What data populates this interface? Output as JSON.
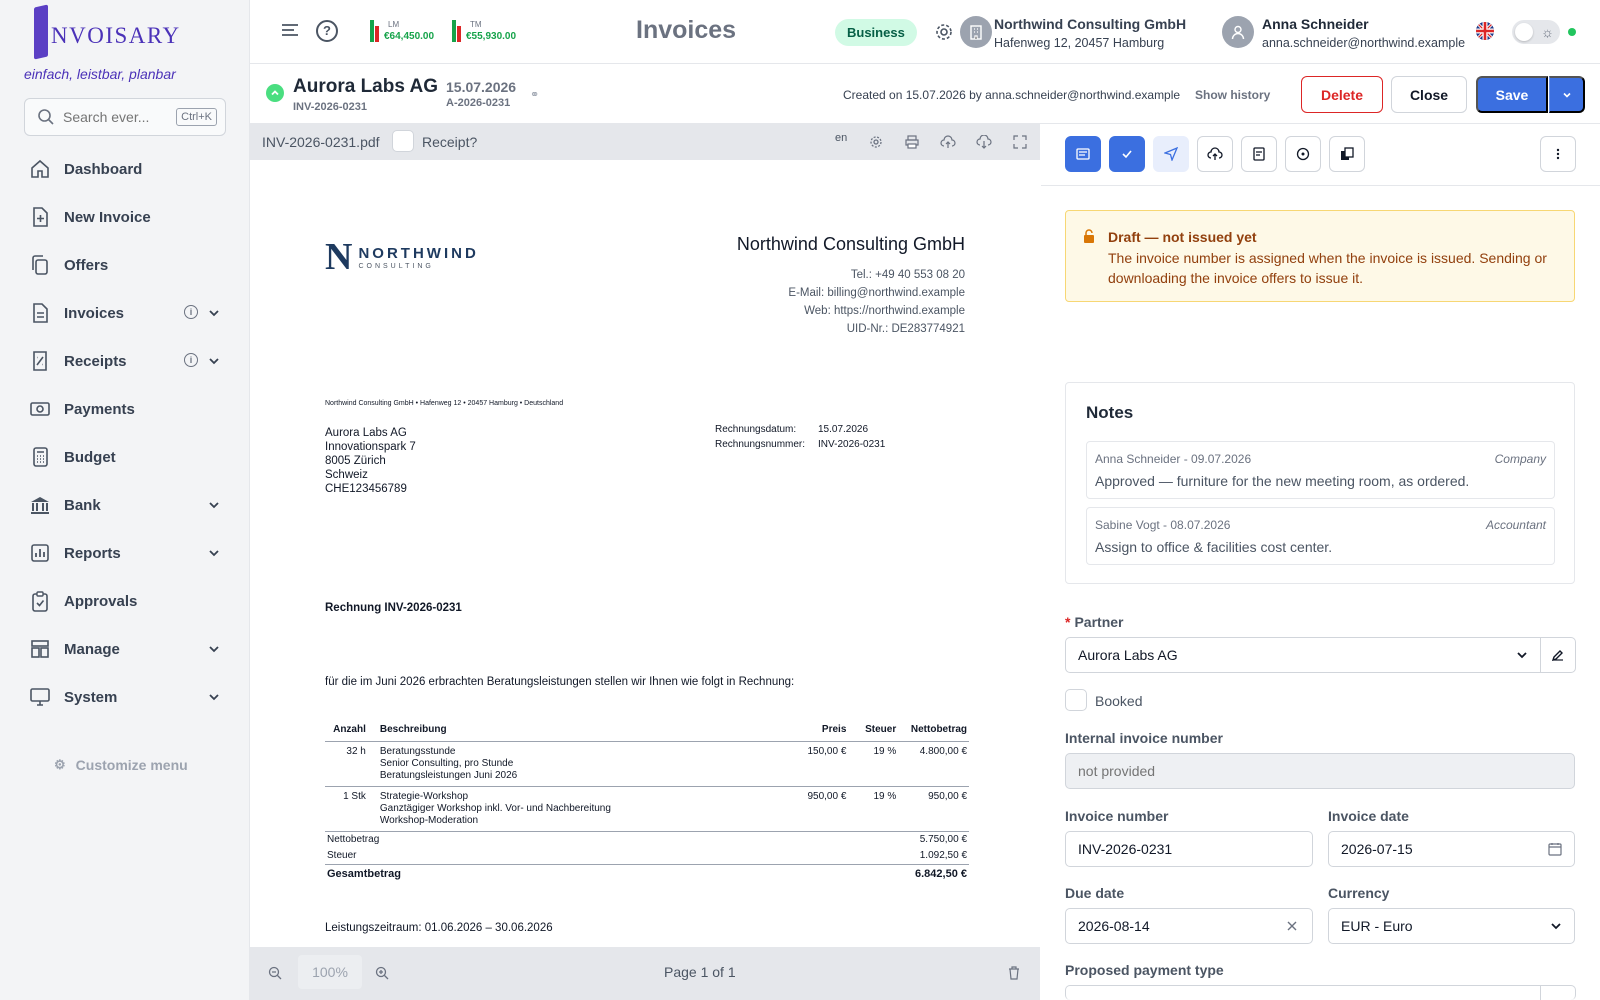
{
  "app": {
    "logo_text": "NVOISARY",
    "tagline": "einfach, leistbar, planbar",
    "search_placeholder": "Search ever...",
    "search_shortcut": "Ctrl+K",
    "customize_menu": "Customize menu"
  },
  "sidebar": {
    "items": [
      {
        "label": "Dashboard",
        "icon": "home-icon"
      },
      {
        "label": "New Invoice",
        "icon": "file-plus-icon"
      },
      {
        "label": "Offers",
        "icon": "copy-icon"
      },
      {
        "label": "Invoices",
        "icon": "file-icon"
      },
      {
        "label": "Receipts",
        "icon": "receipt-icon"
      },
      {
        "label": "Payments",
        "icon": "money-icon"
      },
      {
        "label": "Budget",
        "icon": "calculator-icon"
      },
      {
        "label": "Bank",
        "icon": "bank-icon"
      },
      {
        "label": "Reports",
        "icon": "chart-icon"
      },
      {
        "label": "Approvals",
        "icon": "clipboard-check-icon"
      },
      {
        "label": "Manage",
        "icon": "dashboard-icon"
      },
      {
        "label": "System",
        "icon": "monitor-icon"
      }
    ]
  },
  "topbar": {
    "kpi_lm_label": "LM",
    "kpi_lm_value": "€64,450.00",
    "kpi_tm_label": "TM",
    "kpi_tm_value": "€55,930.00",
    "title": "Invoices",
    "plan_badge": "Business",
    "company_name": "Northwind Consulting GmbH",
    "company_address": "Hafenweg 12, 20457 Hamburg",
    "user_name": "Anna Schneider",
    "user_email": "anna.schneider@northwind.example",
    "colors": {
      "accent": "#3b6fe0",
      "kpi_green": "#16a34a",
      "kpi_red": "#dc2626"
    }
  },
  "header": {
    "partner": "Aurora Labs AG",
    "invoice_number": "INV-2026-0231",
    "date": "15.07.2026",
    "alt_number": "A-2026-0231",
    "created": "Created on 15.07.2026 by anna.schneider@northwind.example",
    "show_history": "Show history",
    "delete": "Delete",
    "close": "Close",
    "save": "Save"
  },
  "viewer": {
    "filename": "INV-2026-0231.pdf",
    "receipt_label": "Receipt?",
    "lang": "en",
    "zoom": "100%",
    "page_indicator": "Page 1 of 1"
  },
  "pdf": {
    "logo_word": "NORTHWIND",
    "logo_sub": "CONSULTING",
    "company": "Northwind Consulting GmbH",
    "tel": "Tel.: +49 40 553 08 20",
    "email": "E-Mail: billing@northwind.example",
    "web": "Web: https://northwind.example",
    "vat": "UID-Nr.: DE283774921",
    "sender_line": "Northwind Consulting GmbH • Hafenweg 12 • 20457 Hamburg • Deutschland",
    "recipient": [
      "Aurora Labs AG",
      "Innovationspark 7",
      "8005 Zürich",
      "Schweiz",
      "CHE123456789"
    ],
    "meta_date_label": "Rechnungsdatum:",
    "meta_date_value": "15.07.2026",
    "meta_no_label": "Rechnungsnummer:",
    "meta_no_value": "INV-2026-0231",
    "heading": "Rechnung INV-2026-0231",
    "intro": "für die im Juni 2026 erbrachten Beratungsleistungen stellen wir Ihnen wie folgt in Rechnung:",
    "columns": {
      "qty": "Anzahl",
      "desc": "Beschreibung",
      "price": "Preis",
      "tax": "Steuer",
      "net": "Nettobetrag"
    },
    "lines": [
      {
        "qty": "32 h",
        "desc1": "Beratungsstunde",
        "desc2": "Senior Consulting, pro Stunde",
        "desc3": "Beratungsleistungen Juni 2026",
        "price": "150,00 €",
        "tax": "19 %",
        "net": "4.800,00 €"
      },
      {
        "qty": "1 Stk",
        "desc1": "Strategie-Workshop",
        "desc2": "Ganztägiger Workshop inkl. Vor- und Nachbereitung",
        "desc3": "Workshop-Moderation",
        "price": "950,00 €",
        "tax": "19 %",
        "net": "950,00 €"
      }
    ],
    "net_label": "Nettobetrag",
    "net_value": "5.750,00 €",
    "tax_label": "Steuer",
    "tax_value": "1.092,50 €",
    "total_label": "Gesamtbetrag",
    "total_value": "6.842,50 €",
    "period": "Leistungszeitraum: 01.06.2026 – 30.06.2026"
  },
  "panel": {
    "draft_title": "Draft — not issued yet",
    "draft_body": "The invoice number is assigned when the invoice is issued. Sending or downloading the invoice offers to issue it.",
    "notes_title": "Notes",
    "notes": [
      {
        "meta": "Anna Schneider - 09.07.2026",
        "role": "Company",
        "text": "Approved — furniture for the new meeting room, as ordered."
      },
      {
        "meta": "Sabine Vogt - 08.07.2026",
        "role": "Accountant",
        "text": "Assign to office & facilities cost center."
      }
    ],
    "partner_label": "Partner",
    "partner_value": "Aurora Labs AG",
    "booked_label": "Booked",
    "internal_label": "Internal invoice number",
    "internal_placeholder": "not provided",
    "invoice_number_label": "Invoice number",
    "invoice_number_value": "INV-2026-0231",
    "invoice_date_label": "Invoice date",
    "invoice_date_value": "2026-07-15",
    "due_date_label": "Due date",
    "due_date_value": "2026-08-14",
    "currency_label": "Currency",
    "currency_value": "EUR - Euro",
    "payment_type_label": "Proposed payment type"
  }
}
